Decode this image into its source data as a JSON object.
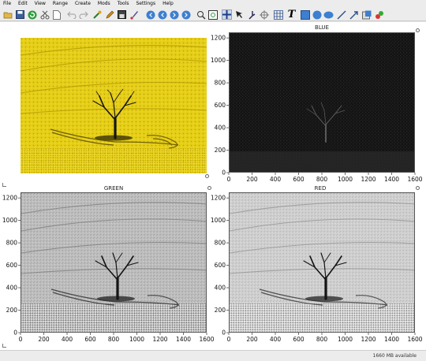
{
  "menu": [
    "File",
    "Edit",
    "View",
    "Range",
    "Create",
    "Mods",
    "Tools",
    "Settings",
    "Help"
  ],
  "toolbar_icons": [
    "open-folder-icon",
    "save-icon",
    "refresh-icon",
    "cut-icon",
    "document-icon",
    "undo-icon",
    "redo-icon",
    "magic-icon",
    "pen-icon",
    "grid-save-icon",
    "brush-icon",
    "nav-first-icon",
    "nav-prev-icon",
    "nav-next-icon",
    "nav-last-icon",
    "zoom-icon",
    "zoom-fit-icon",
    "crosshair-icon",
    "cursor-icon",
    "pan-icon",
    "measure-icon",
    "grid-icon",
    "text-icon",
    "rectangle-icon",
    "circle-icon",
    "ellipse-icon",
    "line-icon",
    "arrow-icon",
    "fill-icon",
    "plugin-icon"
  ],
  "panels": {
    "blue": {
      "title": "BLUE"
    },
    "green": {
      "title": "GREEN"
    },
    "red": {
      "title": "RED"
    }
  },
  "axes": {
    "x_ticks": [
      "0",
      "200",
      "400",
      "600",
      "800",
      "1000",
      "1200",
      "1400",
      "1600"
    ],
    "y_ticks": [
      "0",
      "200",
      "400",
      "600",
      "800",
      "1000",
      "1200"
    ]
  },
  "status": {
    "memory": "1660 MB available"
  },
  "colors": {
    "rapeseed_yellow": "#e6cf17",
    "blue_channel_bg": "#161616",
    "gray_channel_bg": "#bdbdbd"
  }
}
